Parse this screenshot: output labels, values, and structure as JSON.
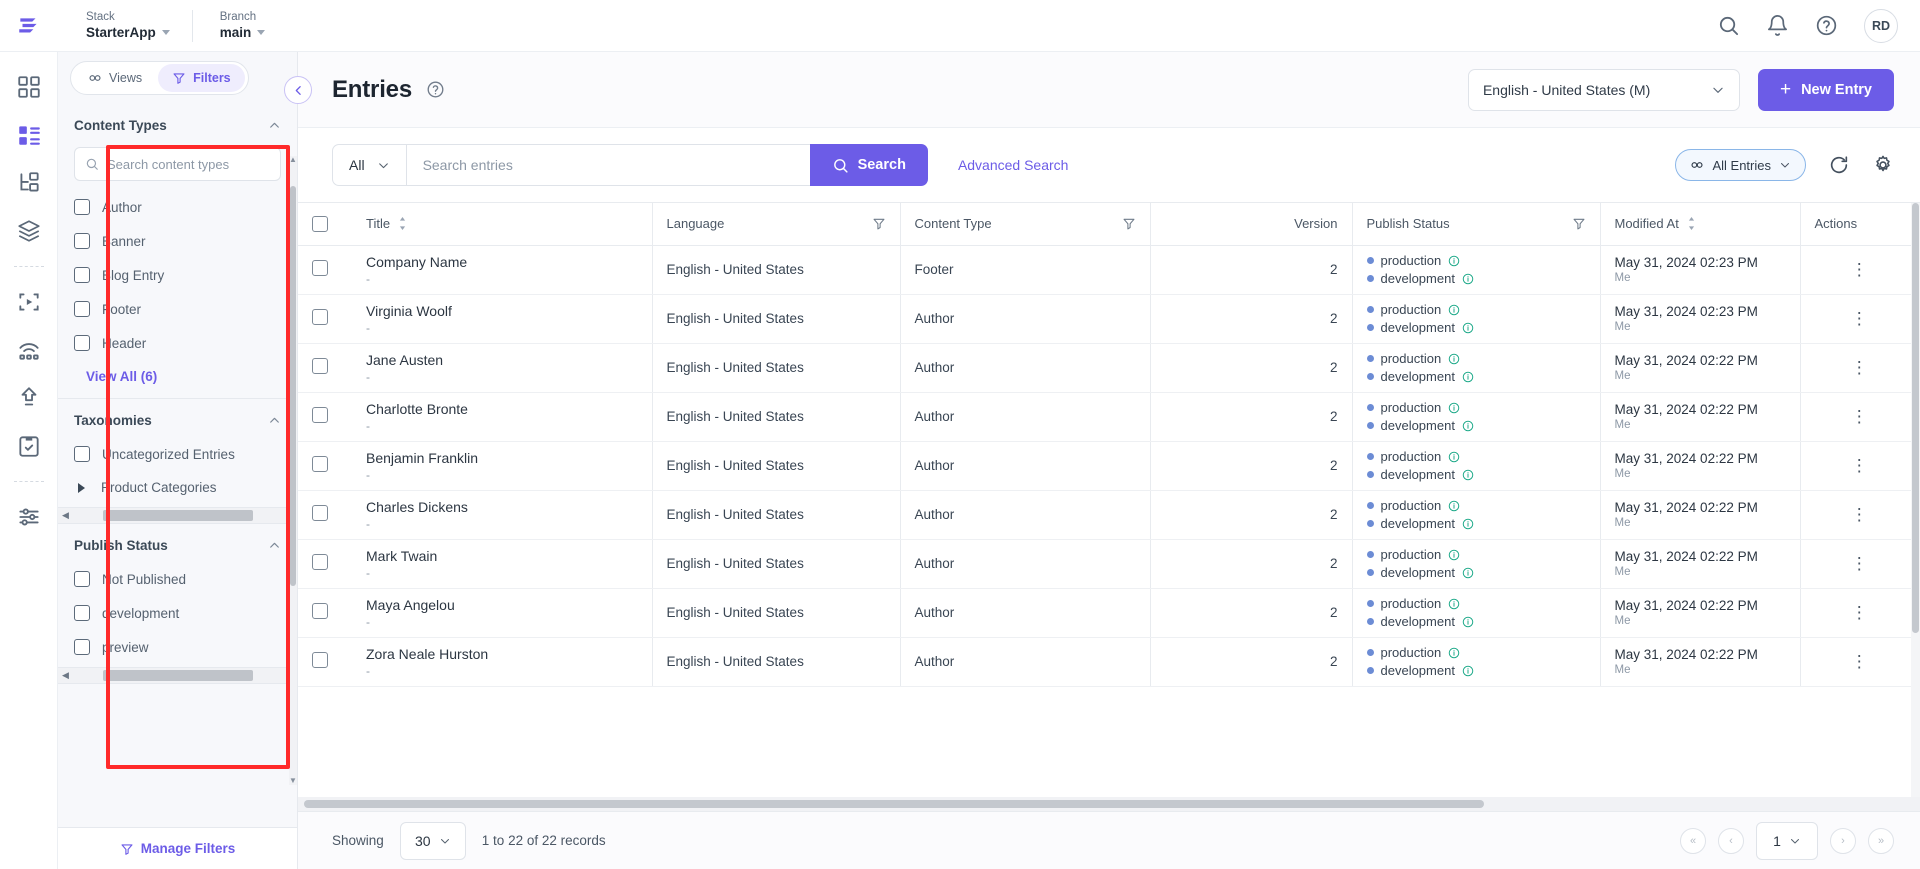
{
  "topbar": {
    "logo_icon": "contentstack-logo-icon",
    "stack": {
      "label": "Stack",
      "value": "StarterApp"
    },
    "branch": {
      "label": "Branch",
      "value": "main"
    },
    "icons": [
      "search-icon",
      "bell-icon",
      "help-circle-icon"
    ],
    "avatar_initials": "RD"
  },
  "rail": {
    "items": [
      {
        "name": "dashboard-icon"
      },
      {
        "name": "entries-icon",
        "active": true
      },
      {
        "name": "content-models-icon"
      },
      {
        "name": "assets-icon"
      },
      {
        "name": "live-preview-icon"
      },
      {
        "name": "webhooks-icon"
      },
      {
        "name": "releases-icon"
      },
      {
        "name": "tasks-icon"
      },
      {
        "name": "settings-icon"
      }
    ]
  },
  "sidebar": {
    "views_tab": {
      "label": "Views",
      "icon": "views-icon",
      "active": false
    },
    "filters_tab": {
      "label": "Filters",
      "icon": "filter-icon",
      "active": true
    },
    "sections": [
      {
        "title": "Content Types",
        "collapsed": false,
        "search_placeholder": "Search content types",
        "search_value": "",
        "items": [
          {
            "label": "Author",
            "checked": false
          },
          {
            "label": "Banner",
            "checked": false
          },
          {
            "label": "Blog Entry",
            "checked": false
          },
          {
            "label": "Footer",
            "checked": false
          },
          {
            "label": "Header",
            "checked": false
          }
        ],
        "view_all": "View All (6)"
      },
      {
        "title": "Taxonomies",
        "collapsed": false,
        "items": [
          {
            "label": "Uncategorized Entries",
            "checked": false,
            "type": "checkbox"
          },
          {
            "label": "Product Categories",
            "type": "tree"
          }
        ]
      },
      {
        "title": "Publish Status",
        "collapsed": false,
        "items": [
          {
            "label": "Not Published",
            "checked": false
          },
          {
            "label": "development",
            "checked": false
          },
          {
            "label": "preview",
            "checked": false
          }
        ]
      }
    ],
    "manage_filters": {
      "label": "Manage Filters",
      "icon": "filter-icon"
    }
  },
  "page": {
    "title": "Entries",
    "help_icon": "help-circle-icon",
    "collapse_icon": "chevron-left-icon",
    "language_selector": "English - United States (M)",
    "new_entry_button": "New Entry"
  },
  "toolbar": {
    "scope_selector": "All",
    "search_placeholder": "Search entries",
    "search_value": "",
    "search_button": "Search",
    "advanced_search": "Advanced Search",
    "view_pill": "All Entries",
    "refresh_icon": "refresh-icon",
    "settings_icon": "gear-icon"
  },
  "table": {
    "columns": [
      {
        "key": "select",
        "label": ""
      },
      {
        "key": "title",
        "label": "Title",
        "sortable": true
      },
      {
        "key": "language",
        "label": "Language",
        "filterable": true
      },
      {
        "key": "content_type",
        "label": "Content Type",
        "filterable": true
      },
      {
        "key": "version",
        "label": "Version",
        "align": "right"
      },
      {
        "key": "publish_status",
        "label": "Publish Status",
        "filterable": true
      },
      {
        "key": "modified_at",
        "label": "Modified At",
        "sortable": true
      },
      {
        "key": "actions",
        "label": "Actions"
      }
    ],
    "rows": [
      {
        "title": "Company Name",
        "subtitle": "-",
        "language": "English - United States",
        "content_type": "Footer",
        "version": "2",
        "statuses": [
          "production",
          "development"
        ],
        "modified_at": "May 31, 2024 02:23 PM",
        "modified_by": "Me"
      },
      {
        "title": "Virginia Woolf",
        "subtitle": "-",
        "language": "English - United States",
        "content_type": "Author",
        "version": "2",
        "statuses": [
          "production",
          "development"
        ],
        "modified_at": "May 31, 2024 02:23 PM",
        "modified_by": "Me"
      },
      {
        "title": "Jane Austen",
        "subtitle": "-",
        "language": "English - United States",
        "content_type": "Author",
        "version": "2",
        "statuses": [
          "production",
          "development"
        ],
        "modified_at": "May 31, 2024 02:22 PM",
        "modified_by": "Me"
      },
      {
        "title": "Charlotte Bronte",
        "subtitle": "-",
        "language": "English - United States",
        "content_type": "Author",
        "version": "2",
        "statuses": [
          "production",
          "development"
        ],
        "modified_at": "May 31, 2024 02:22 PM",
        "modified_by": "Me"
      },
      {
        "title": "Benjamin Franklin",
        "subtitle": "-",
        "language": "English - United States",
        "content_type": "Author",
        "version": "2",
        "statuses": [
          "production",
          "development"
        ],
        "modified_at": "May 31, 2024 02:22 PM",
        "modified_by": "Me"
      },
      {
        "title": "Charles Dickens",
        "subtitle": "-",
        "language": "English - United States",
        "content_type": "Author",
        "version": "2",
        "statuses": [
          "production",
          "development"
        ],
        "modified_at": "May 31, 2024 02:22 PM",
        "modified_by": "Me"
      },
      {
        "title": "Mark Twain",
        "subtitle": "-",
        "language": "English - United States",
        "content_type": "Author",
        "version": "2",
        "statuses": [
          "production",
          "development"
        ],
        "modified_at": "May 31, 2024 02:22 PM",
        "modified_by": "Me"
      },
      {
        "title": "Maya Angelou",
        "subtitle": "-",
        "language": "English - United States",
        "content_type": "Author",
        "version": "2",
        "statuses": [
          "production",
          "development"
        ],
        "modified_at": "May 31, 2024 02:22 PM",
        "modified_by": "Me"
      },
      {
        "title": "Zora Neale Hurston",
        "subtitle": "-",
        "language": "English - United States",
        "content_type": "Author",
        "version": "2",
        "statuses": [
          "production",
          "development"
        ],
        "modified_at": "May 31, 2024 02:22 PM",
        "modified_by": "Me"
      }
    ]
  },
  "footer": {
    "showing_label": "Showing",
    "page_size": "30",
    "records_label": "1 to 22 of 22 records",
    "page_number": "1"
  },
  "colors": {
    "accent": "#6c5ce7",
    "annotation": "#ff2a2a",
    "status_dot": "#6c8cd5",
    "info_icon": "#1faa8a"
  }
}
